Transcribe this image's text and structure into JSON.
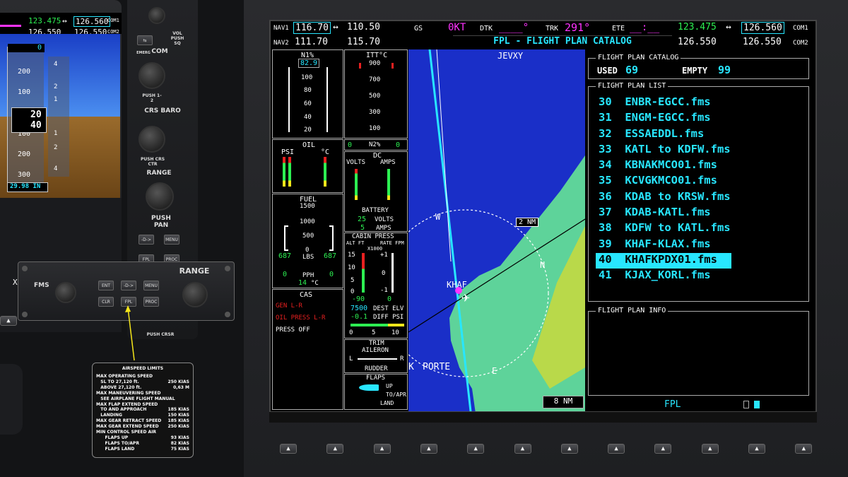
{
  "pfd": {
    "com_active_1": "123.475",
    "com_standby_1": "126.560",
    "com_label_1": "COM1",
    "com_active_2": "126.550",
    "com_standby_2": "126.550",
    "com_label_2": "COM2",
    "alt_ticks": [
      "200",
      "100",
      "100",
      "200",
      "300"
    ],
    "alt_box": "0",
    "alt_current_hi": "20",
    "alt_current_lo": "40",
    "vs_ticks": [
      "4",
      "2",
      "1",
      "1",
      "2",
      "4"
    ],
    "baro": "29.98 IN",
    "x_label": "X"
  },
  "bezel": {
    "vol_label": "VOL PUSH SQ",
    "emerg_label": "EMERG",
    "com_label": "COM",
    "push_12": "PUSH 1-2",
    "crs_baro": "CRS BARO",
    "push_crs_ctr": "PUSH CRS CTR",
    "range": "RANGE",
    "push_pan": "PUSH PAN",
    "direct_key": "-D->",
    "menu_key": "MENU",
    "fpl_key": "FPL",
    "proc_key": "PROC",
    "push_crsr": "PUSH CRSR"
  },
  "fms_zoom": {
    "fms_label": "FMS",
    "range_label": "RANGE",
    "ent": "ENT",
    "direct": "-D->",
    "menu": "MENU",
    "clr": "CLR",
    "fpl": "FPL",
    "proc": "PROC"
  },
  "placard": {
    "title": "AIRSPEED LIMITS",
    "rows": [
      {
        "l": "MAX OPERATING SPEED",
        "r": ""
      },
      {
        "l": "   SL TO 27,120 ft.",
        "r": "250 KIAS"
      },
      {
        "l": "   ABOVE 27,120 ft.",
        "r": "0,63 M"
      },
      {
        "l": "MAX MANEUVERING SPEED",
        "r": ""
      },
      {
        "l": "   SEE AIRPLANE FLIGHT MANUAL",
        "r": ""
      },
      {
        "l": "MAX FLAP EXTEND SPEED",
        "r": ""
      },
      {
        "l": "   TO AND APPROACH",
        "r": "185 KIAS"
      },
      {
        "l": "   LANDING",
        "r": "150 KIAS"
      },
      {
        "l": "MAX GEAR RETRACT SPEED",
        "r": "185 KIAS"
      },
      {
        "l": "MAX GEAR EXTEND SPEED",
        "r": "250 KIAS"
      },
      {
        "l": "MIN CONTROL SPEED AIR",
        "r": ""
      },
      {
        "l": "      FLAPS UP",
        "r": "93 KIAS"
      },
      {
        "l": "      FLAPS TO/APR",
        "r": "82 KIAS"
      },
      {
        "l": "      FLAPS LAND",
        "r": "75 KIAS"
      }
    ]
  },
  "mfd_top": {
    "nav1_label": "NAV1",
    "nav1_active": "116.70",
    "nav1_standby": "110.50",
    "nav2_label": "NAV2",
    "nav2_active": "111.70",
    "nav2_standby": "115.70",
    "gs_label": "GS",
    "gs_value": "0KT",
    "dtk_label": "DTK",
    "dtk_value": "____°",
    "trk_label": "TRK",
    "trk_value": "291°",
    "ete_label": "ETE",
    "ete_value": "__:__",
    "page_title": "FPL - FLIGHT PLAN CATALOG",
    "com1_active": "123.475",
    "com1_standby": "126.560",
    "com1_label": "COM1",
    "com2_active": "126.550",
    "com2_standby": "126.550",
    "com2_label": "COM2"
  },
  "eis": {
    "n1_label": "N1%",
    "n1_value": "82.9",
    "n1_ticks": [
      "100",
      "80",
      "60",
      "40",
      "20"
    ],
    "itt_label": "ITT°C",
    "itt_ticks": [
      "900",
      "700",
      "500",
      "300",
      "100"
    ],
    "n2_label": "N2%",
    "n2_left": "0",
    "n2_right": "0",
    "oil_label": "OIL",
    "psi": "PSI",
    "deg_c": "°C",
    "dc_label": "DC",
    "volts_label": "VOLTS",
    "amps_label": "AMPS",
    "battery_label": "BATTERY",
    "batt_volts": "25",
    "batt_volts_unit": "VOLTS",
    "batt_amps": "5",
    "batt_amps_unit": "AMPS",
    "fuel_label": "FUEL",
    "fuel_ticks": [
      "1500",
      "1000",
      "500",
      "0"
    ],
    "fuel_left": "687",
    "fuel_unit": "LBS",
    "fuel_right": "687",
    "pph_label": "PPH",
    "pph_left": "0",
    "pph_right": "0",
    "temp_val": "14",
    "temp_unit": "°C",
    "cas_label": "CAS",
    "cas_msgs": [
      {
        "text": "GEN L-R",
        "color": "red"
      },
      {
        "text": "OIL PRESS L-R",
        "color": "red"
      },
      {
        "text": "PRESS OFF",
        "color": "white"
      }
    ],
    "cabin_label": "CABIN PRESS",
    "alt_ft": "ALT FT",
    "rate_fpm": "RATE FPM",
    "x1000": "X1000",
    "cab_ticks_l": [
      "15",
      "10",
      "5",
      "0"
    ],
    "cab_ticks_r": [
      "+1",
      "0",
      "-1"
    ],
    "cab_alt_val": "-90",
    "cab_rate_val": "0",
    "dest_val": "7500",
    "dest_label": "DEST ELV",
    "diff_val": "-0.1",
    "diff_label": "DIFF PSI",
    "diff_ticks": [
      "0",
      "5",
      "10"
    ],
    "trim_label": "TRIM",
    "aileron": "AILERON",
    "trim_l": "L",
    "trim_r": "R",
    "rudder": "RUDDER",
    "flaps_label": "FLAPS",
    "flap_up": "UP",
    "flap_to": "TO/APR",
    "flap_land": "LAND"
  },
  "map": {
    "wpt_top": "JEVXY",
    "range_box": "2 NM",
    "airport": "KHAF",
    "porte": "PORTE",
    "k_label": "K",
    "compass_n": "N",
    "compass_e": "E",
    "compass_w": "W",
    "range_bottom": "8 NM"
  },
  "fpl": {
    "catalog_title": "FLIGHT PLAN CATALOG",
    "used_label": "USED",
    "used_value": "69",
    "empty_label": "EMPTY",
    "empty_value": "99",
    "list_title": "FLIGHT PLAN LIST",
    "items": [
      "30  ENBR-EGCC.fms",
      "31  ENGM-EGCC.fms",
      "32  ESSAEDDL.fms",
      "33  KATL to KDFW.fms",
      "34  KBNAKMCO01.fms",
      "35  KCVGKMCO01.fms",
      "36  KDAB to KRSW.fms",
      "37  KDAB-KATL.fms",
      "38  KDFW to KATL.fms",
      "39  KHAF-KLAX.fms",
      "40  KHAFKPDX01.fms",
      "41  KJAX_KORL.fms"
    ],
    "selected_index": 10,
    "info_title": "FLIGHT PLAN INFO",
    "page_group": "FPL"
  },
  "colors": {
    "cyan": "#28e6ff",
    "green": "#2df052",
    "magenta": "#ff33ff",
    "annotation_arrow": "#f5e61a"
  }
}
